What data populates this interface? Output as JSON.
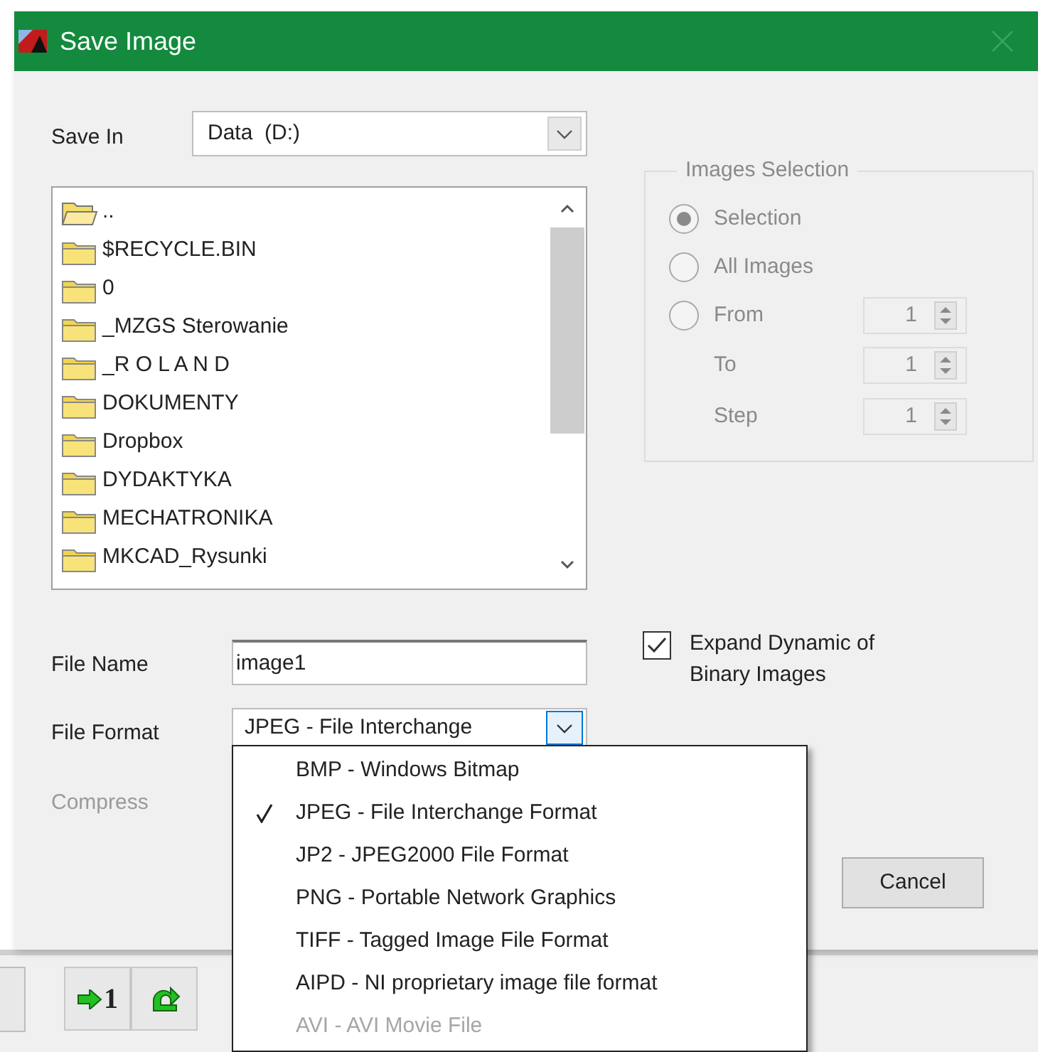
{
  "window": {
    "title": "Save Image"
  },
  "save_in": {
    "label": "Save In",
    "value": "Data  (D:)"
  },
  "folders": [
    {
      "name": "..",
      "kind": "parent"
    },
    {
      "name": "$RECYCLE.BIN",
      "kind": "folder"
    },
    {
      "name": "0",
      "kind": "folder"
    },
    {
      "name": "_MZGS Sterowanie",
      "kind": "folder"
    },
    {
      "name": "_R O L A N D",
      "kind": "folder"
    },
    {
      "name": "DOKUMENTY",
      "kind": "folder"
    },
    {
      "name": "Dropbox",
      "kind": "folder"
    },
    {
      "name": "DYDAKTYKA",
      "kind": "folder"
    },
    {
      "name": "MECHATRONIKA",
      "kind": "folder"
    },
    {
      "name": "MKCAD_Rysunki",
      "kind": "folder"
    }
  ],
  "images_selection": {
    "title": "Images Selection",
    "disabled": true,
    "options": [
      {
        "label": "Selection",
        "selected": true
      },
      {
        "label": "All Images",
        "selected": false
      },
      {
        "label": "From",
        "selected": false,
        "value": "1"
      }
    ],
    "ranges": [
      {
        "label": "To",
        "value": "1"
      },
      {
        "label": "Step",
        "value": "1"
      }
    ]
  },
  "file_name": {
    "label": "File Name",
    "value": "image1"
  },
  "expand_dynamic": {
    "label": "Expand Dynamic of Binary Images",
    "checked": true
  },
  "file_format": {
    "label": "File Format",
    "value": "JPEG - File Interchange",
    "expanded": true,
    "options": [
      {
        "label": "BMP - Windows Bitmap",
        "selected": false,
        "disabled": false
      },
      {
        "label": "JPEG - File Interchange Format",
        "selected": true,
        "disabled": false
      },
      {
        "label": "JP2 - JPEG2000 File Format",
        "selected": false,
        "disabled": false
      },
      {
        "label": "PNG - Portable Network Graphics",
        "selected": false,
        "disabled": false
      },
      {
        "label": "TIFF - Tagged Image File Format",
        "selected": false,
        "disabled": false
      },
      {
        "label": "AIPD - NI proprietary image file format",
        "selected": false,
        "disabled": false
      },
      {
        "label": "AVI - AVI Movie File",
        "selected": false,
        "disabled": true
      }
    ]
  },
  "compress": {
    "label": "Compress",
    "disabled": true
  },
  "buttons": [
    {
      "label": "Cancel"
    }
  ],
  "toolbar": [
    {
      "kind": "goto",
      "label": "1"
    },
    {
      "kind": "refresh"
    }
  ]
}
